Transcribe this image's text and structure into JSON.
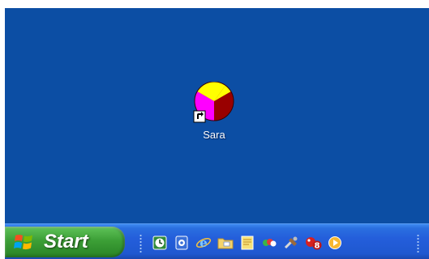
{
  "desktop": {
    "background_color": "#0c4ea4",
    "icons": [
      {
        "label": "Sara",
        "icon": "pie-chart-shortcut-icon",
        "colors": [
          "#ffff00",
          "#ff00ff",
          "#990000"
        ]
      }
    ]
  },
  "taskbar": {
    "start_label": "Start",
    "start_color": "#3c9f36",
    "taskbar_color": "#245edb",
    "quick_launch": [
      {
        "icon": "clock-icon"
      },
      {
        "icon": "gear-app-icon"
      },
      {
        "icon": "internet-explorer-icon"
      },
      {
        "icon": "folder-icon"
      },
      {
        "icon": "document-icon"
      },
      {
        "icon": "messenger-icon"
      },
      {
        "icon": "tools-icon"
      },
      {
        "icon": "badge-8-icon",
        "badge": "8"
      },
      {
        "icon": "media-player-icon"
      }
    ]
  }
}
